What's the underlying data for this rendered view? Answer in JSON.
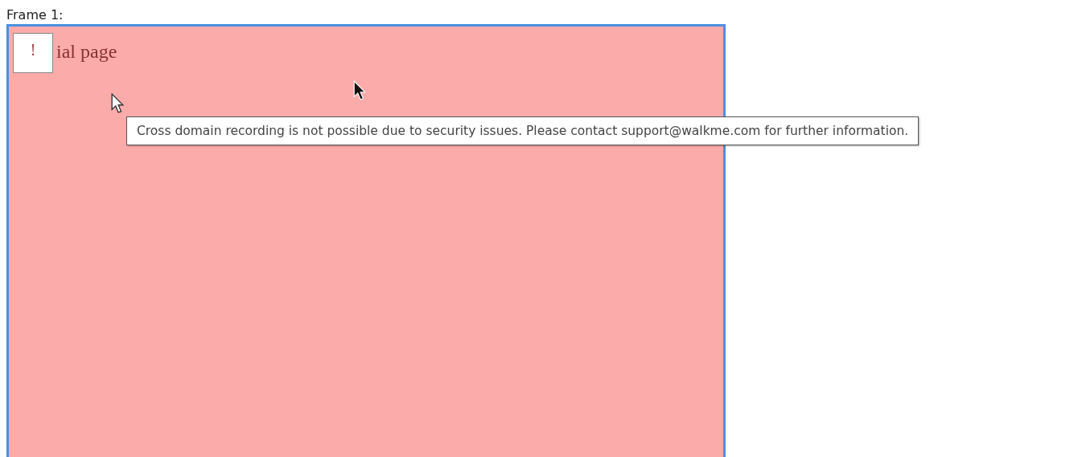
{
  "frame": {
    "label": "Frame 1:",
    "badge": "!",
    "heading": "ial page"
  },
  "tooltip": {
    "text": "Cross domain recording is not possible due to security issues. Please contact support@walkme.com for further information."
  }
}
